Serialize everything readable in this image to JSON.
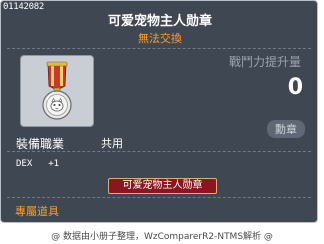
{
  "item": {
    "id": "01142082",
    "name": "可爱宠物主人勋章",
    "trade_status": "無法交換",
    "icon": "medal-icon",
    "stat_label": "戰鬥力提升量",
    "stat_value": "0",
    "category_tag": "勳章",
    "job_label": "裝備職業",
    "job_value": "共用",
    "stats": [
      {
        "name": "DEX",
        "value": "+1"
      }
    ],
    "medal_name_tag": "可爱宠物主人勋章",
    "exclusive_label": "專屬道具"
  },
  "footer": "@ 数据由小册子整理，WzComparerR2-NTMS解析 @",
  "colors": {
    "panel_bg": "#3f4752",
    "accent_orange": "#ff9c2a",
    "medal_tag_bg": "#8a1720"
  }
}
